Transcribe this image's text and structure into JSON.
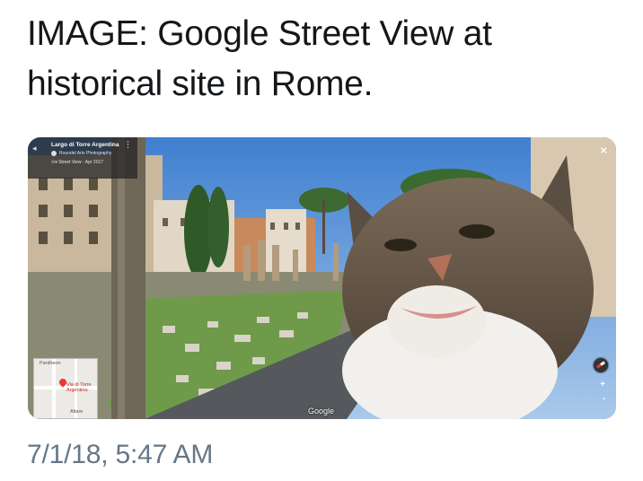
{
  "tweet": {
    "text_line1": "IMAGE: Google Street View at",
    "text_line2": "historical site in Rome.",
    "timestamp": "7/1/18, 5:47 AM"
  },
  "street_view": {
    "place_title": "Largo di Torre Argentina",
    "photographer": "Roundel Arts Photography",
    "capture": "Street View - Apr 2017",
    "close_label": "×",
    "watermark": "Google",
    "zoom_in": "+",
    "zoom_out": "-",
    "minimap": {
      "pin_label": "Via di Torre Argentina",
      "label_top": "Pantheon",
      "label_bottom": "Altare"
    }
  },
  "colors": {
    "sky": "#5b95d8",
    "timestamp": "#657786",
    "text": "#14171a"
  }
}
